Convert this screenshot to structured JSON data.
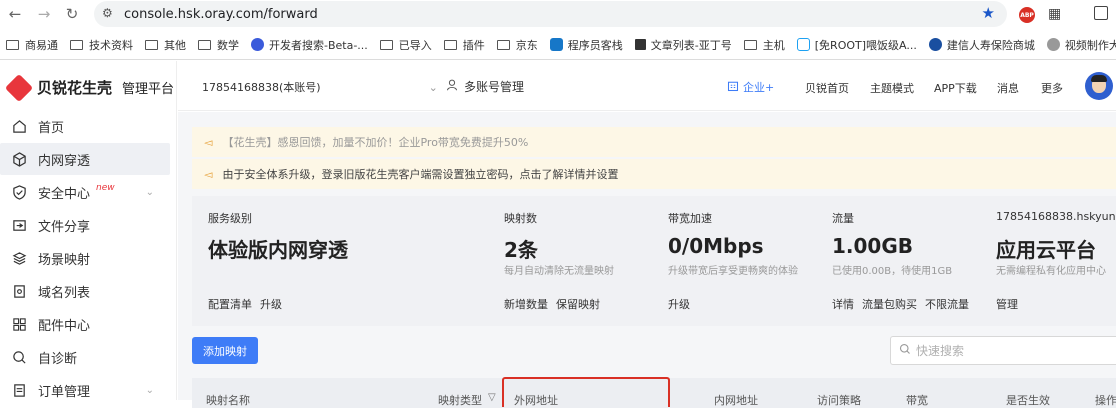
{
  "browser": {
    "url": "console.hsk.oray.com/forward",
    "bookmarks": [
      "商易通",
      "技术资料",
      "其他",
      "数学",
      "开发者搜索-Beta-...",
      "已导入",
      "插件",
      "京东",
      "程序员客栈",
      "文章列表-亚丁号",
      "主机",
      "[免ROOT]喂饭级A...",
      "建信人寿保险商城",
      "视频制作大叔独家..."
    ]
  },
  "sidebar": {
    "brand": "贝锐花生壳",
    "brand_sub": "管理平台",
    "items": [
      {
        "label": "首页",
        "icon": "home-icon"
      },
      {
        "label": "内网穿透",
        "icon": "cube-icon"
      },
      {
        "label": "安全中心",
        "icon": "shield-icon",
        "badge": "new"
      },
      {
        "label": "文件分享",
        "icon": "folder-share-icon"
      },
      {
        "label": "场景映射",
        "icon": "scene-icon"
      },
      {
        "label": "域名列表",
        "icon": "domain-icon"
      },
      {
        "label": "配件中心",
        "icon": "grid-icon"
      },
      {
        "label": "自诊断",
        "icon": "search-diagnose-icon"
      },
      {
        "label": "订单管理",
        "icon": "order-icon"
      }
    ]
  },
  "topbar": {
    "account": "17854168838(本账号)",
    "multi_account": "多账号管理",
    "enterprise": "企业+",
    "nav": [
      "贝锐首页",
      "主题模式",
      "APP下载",
      "消息",
      "更多"
    ]
  },
  "notices": [
    "【花生壳】感恩回馈，加量不加价！企业Pro带宽免费提升50%",
    "由于安全体系升级，登录旧版花生壳客户端需设置独立密码，点击了解详情并设置"
  ],
  "stats": [
    {
      "label": "服务级别",
      "value": "体验版内网穿透",
      "sub": "",
      "links": [
        "配置清单",
        "升级"
      ]
    },
    {
      "label": "映射数",
      "value": "2条",
      "sub": "每月自动清除无流量映射",
      "links": [
        "新增数量",
        "保留映射"
      ]
    },
    {
      "label": "带宽加速",
      "value": "0/0Mbps",
      "sub": "升级带宽后享受更畅爽的体验",
      "links": [
        "升级"
      ]
    },
    {
      "label": "流量",
      "value": "1.00GB",
      "sub": "已使用0.00B，待使用1GB",
      "links": [
        "详情",
        "流量包购买",
        "不限流量"
      ]
    },
    {
      "label": "17854168838.hskyun.com",
      "value": "应用云平台",
      "sub": "无需编程私有化应用中心",
      "links": [
        "管理"
      ]
    }
  ],
  "actions": {
    "add_mapping": "添加映射",
    "search_placeholder": "快速搜索"
  },
  "table": {
    "headers": [
      "映射名称",
      "映射类型",
      "外网地址",
      "内网地址",
      "访问策略",
      "带宽",
      "是否生效",
      "操作"
    ]
  }
}
